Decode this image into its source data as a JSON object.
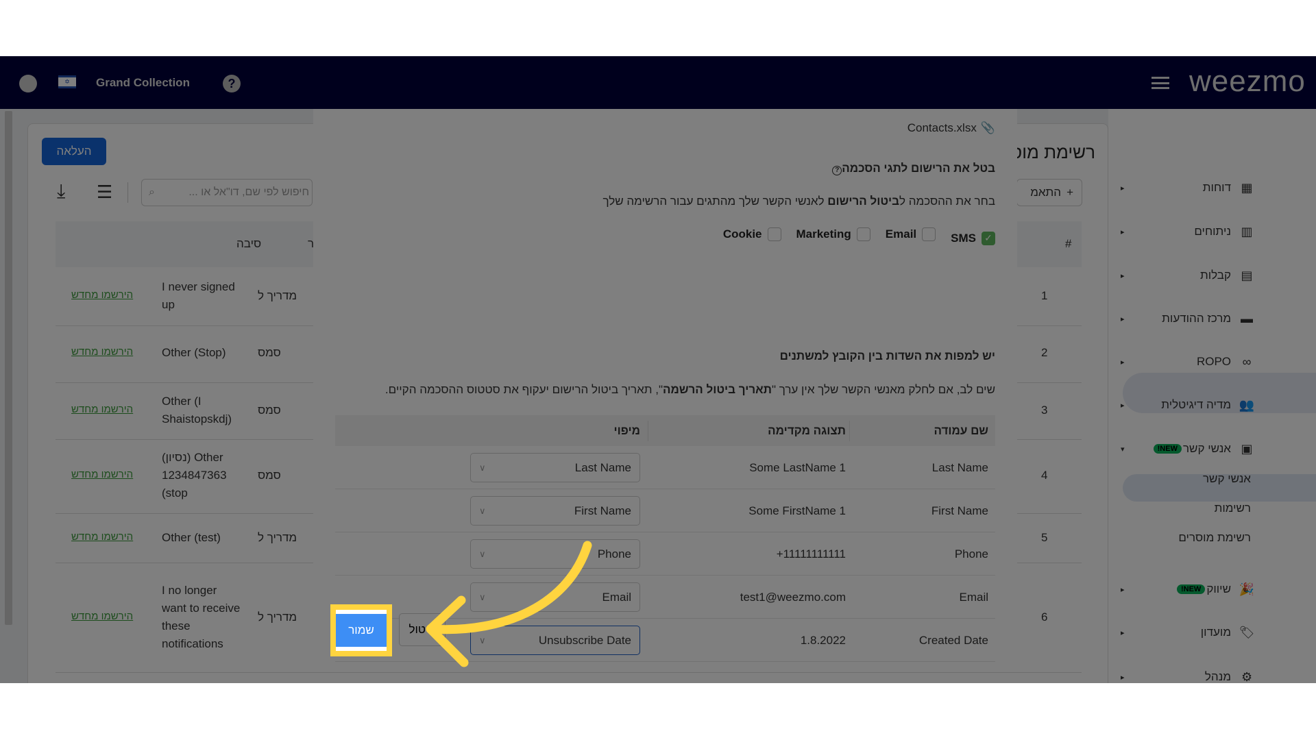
{
  "header": {
    "store_name": "Grand Collection",
    "logo": "weezmo",
    "icons": [
      "user-icon",
      "israel-flag-icon",
      "help-icon",
      "hamburger-icon"
    ]
  },
  "main": {
    "title": "רשימת מוסרים",
    "upload_label": "העלאה",
    "add_label": "התאמ",
    "search_placeholder": "חיפוש לפי שם, דו\"אל או ...",
    "columns": {
      "number": "#",
      "source": "מקור",
      "reason": "סיבה"
    },
    "rows": [
      {
        "n": "1",
        "source": "מדריך ל",
        "reason": "I never signed up",
        "action": "הירשמו מחדש"
      },
      {
        "n": "2",
        "source": "סמס",
        "reason": "Other (Stop)",
        "action": "הירשמו מחדש"
      },
      {
        "n": "3",
        "source": "סמס",
        "reason": "Other (I Shaistopskdj)",
        "action": "הירשמו מחדש"
      },
      {
        "n": "4",
        "source": "סמס",
        "reason": "(נסיון) Other 1234847363 (stop",
        "action": "הירשמו מחדש"
      },
      {
        "n": "5",
        "source": "מדריך ל",
        "reason": "Other (test)",
        "action": "הירשמו מחדש"
      },
      {
        "n": "6",
        "source": "מדריך ל",
        "reason": "I no longer want to receive these notifications",
        "action": "הירשמו מחדש"
      }
    ]
  },
  "sidebar": {
    "items": [
      {
        "label": "דוחות",
        "icon": "dashboard-icon"
      },
      {
        "label": "ניתוחים",
        "icon": "analytics-icon"
      },
      {
        "label": "קבלות",
        "icon": "receipt-icon"
      },
      {
        "label": "מרכז ההודעות",
        "icon": "message-icon"
      },
      {
        "label": "ROPO",
        "icon": "infinity-icon"
      },
      {
        "label": "מדיה דיגיטלית",
        "icon": "group-icon"
      },
      {
        "label": "אנשי קשר",
        "icon": "contacts-icon",
        "badge": "NEW!"
      },
      {
        "label": "שיווק",
        "icon": "party-icon",
        "badge": "NEW!"
      },
      {
        "label": "מועדון",
        "icon": "tag-icon"
      },
      {
        "label": "מנהל",
        "icon": "gear-icon"
      }
    ],
    "subitems": [
      "אנשי קשר",
      "רשימות",
      "רשימת מוסרים"
    ],
    "active_subitem": "רשימת מוסרים"
  },
  "modal": {
    "file_name": "Contacts.xlsx",
    "consent_title": "בטל את הרישום לתגי הסכמה",
    "consent_desc_pre": "בחר את ההסכמה ל",
    "consent_desc_bold": "ביטול הרישום",
    "consent_desc_post": " לאנשי הקשר שלך מהתגים עבור הרשימה שלך",
    "checkboxes": [
      {
        "label": "SMS",
        "checked": true
      },
      {
        "label": "Email",
        "checked": false
      },
      {
        "label": "Marketing",
        "checked": false
      },
      {
        "label": "Cookie",
        "checked": false
      }
    ],
    "map_title": "יש למפות את השדות בין הקובץ למשתנים",
    "note_pre": "שים לב, אם לחלק מאנשי הקשר שלך אין ערך \"",
    "note_bold": "תאריך ביטול הרשמה",
    "note_post": "\", תאריך ביטול הרישום יעקוף את סטטוס ההסכמה הקיים.",
    "columns": {
      "name": "שם עמודה",
      "preview": "תצוגה מקדימה",
      "mapping": "מיפוי"
    },
    "rows": [
      {
        "name": "Last Name",
        "preview": "Some LastName 1",
        "mapping": "Last Name"
      },
      {
        "name": "First Name",
        "preview": "Some FirstName 1",
        "mapping": "First Name"
      },
      {
        "name": "Phone",
        "preview": "+11111111111",
        "mapping": "Phone"
      },
      {
        "name": "Email",
        "preview": "test1@weezmo.com",
        "mapping": "Email"
      },
      {
        "name": "Created Date",
        "preview": "1.8.2022",
        "mapping": "Unsubscribe Date"
      }
    ],
    "save_label": "שמור",
    "cancel_label": "ביטול"
  },
  "colors": {
    "header": "#00003a",
    "primary": "#1565d8",
    "save": "#3d8ef5",
    "highlight": "#ffd43f",
    "link": "#3a9a3a",
    "badge": "#0ab35a"
  }
}
